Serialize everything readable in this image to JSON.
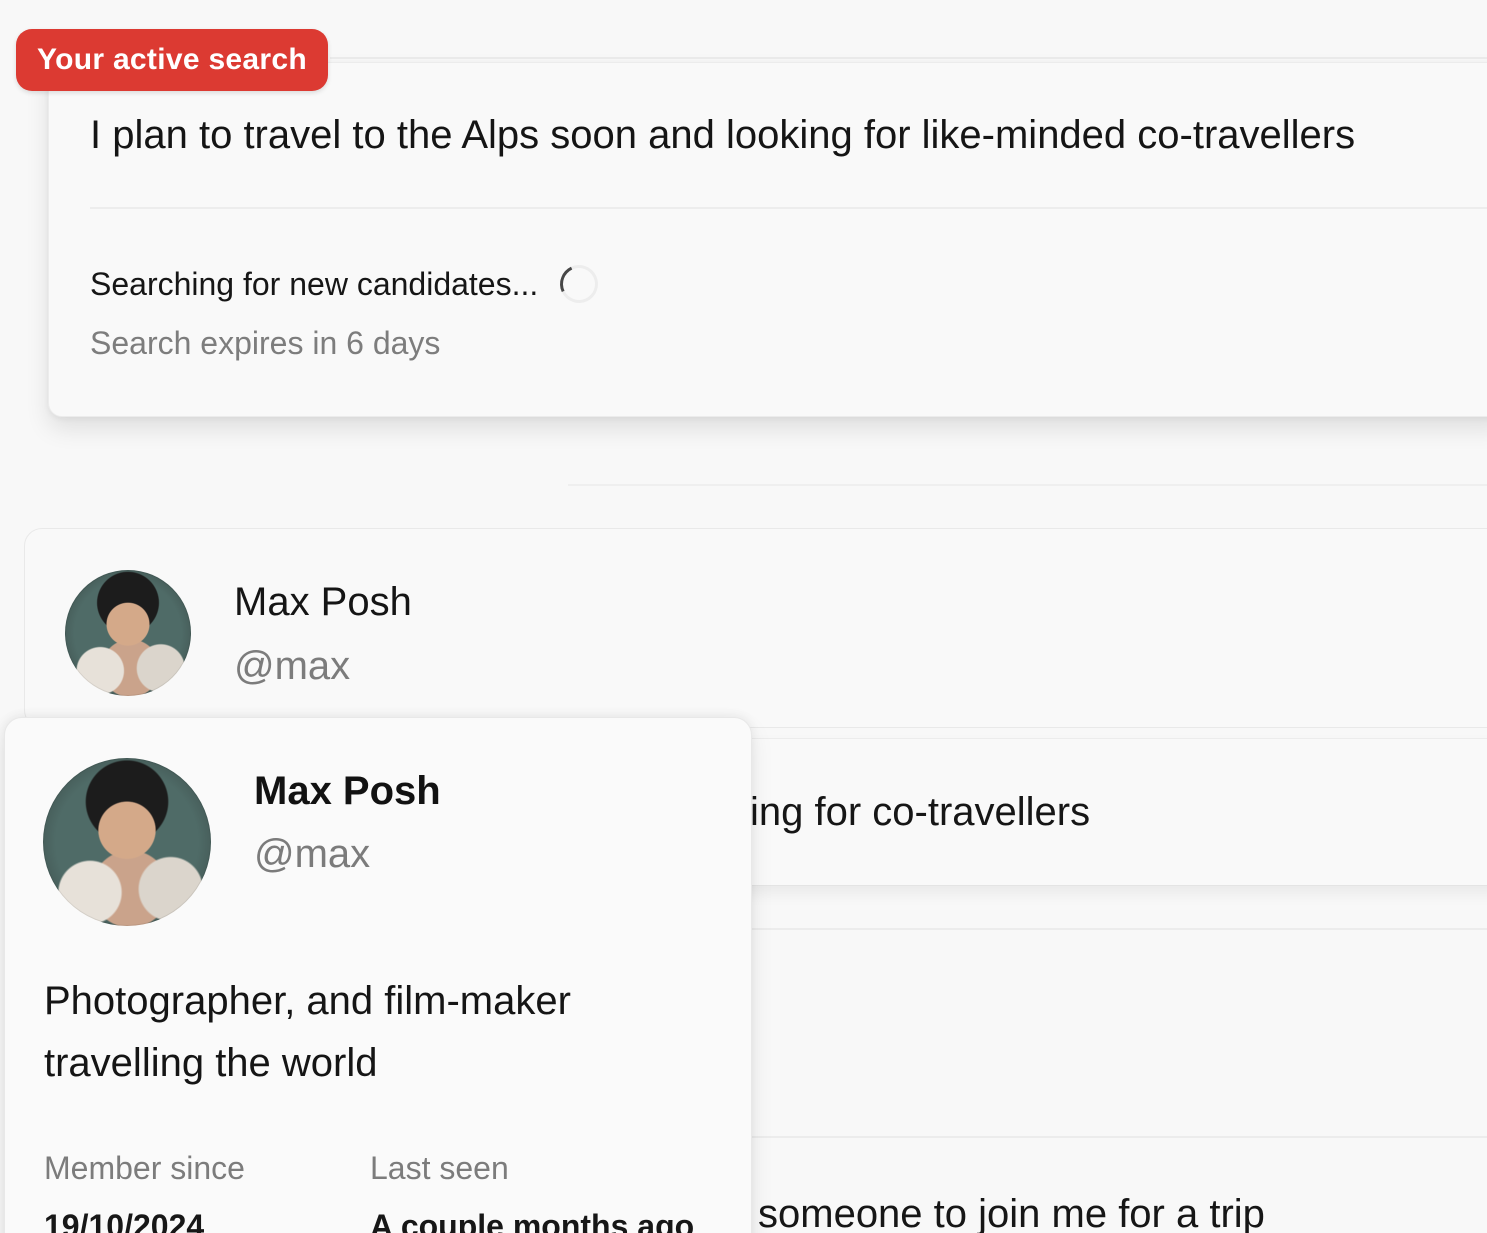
{
  "active_search": {
    "badge": "Your active search",
    "query": "I plan to travel to the Alps soon and looking for like-minded co-travellers",
    "status": "Searching for new candidates...",
    "expiry": "Search expires in 6 days"
  },
  "result_card": {
    "name": "Max Posh",
    "handle": "@max",
    "avatar_icon": "person-photo"
  },
  "results_background": {
    "snippet_2": "ing for co-travellers",
    "snippet_3": "someone to join me for a trip"
  },
  "profile_popover": {
    "name": "Max Posh",
    "handle": "@max",
    "bio": "Photographer, and film-maker travelling the world",
    "member_since_label": "Member since",
    "member_since_value": "19/10/2024",
    "last_seen_label": "Last seen",
    "last_seen_value": "A couple months ago",
    "avatar_icon": "person-photo"
  },
  "colors": {
    "badge_bg": "#dc3a32",
    "page_bg": "#f8f8f8",
    "muted_text": "#7c7c7c"
  }
}
